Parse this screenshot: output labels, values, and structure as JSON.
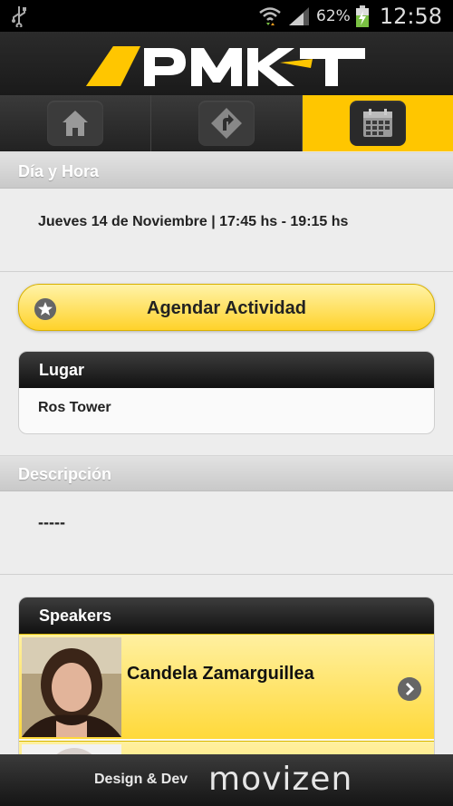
{
  "status_bar": {
    "battery_percent": "62%",
    "time": "12:58",
    "icons": [
      "usb-icon",
      "wifi-icon",
      "signal-icon",
      "battery-charging-icon"
    ]
  },
  "app": {
    "logo_text": "APMKT",
    "accent_color": "#ffc600"
  },
  "tabs": [
    {
      "name": "home",
      "icon": "home-icon",
      "active": false
    },
    {
      "name": "directions",
      "icon": "directions-sign-icon",
      "active": false
    },
    {
      "name": "calendar",
      "icon": "calendar-icon",
      "active": true
    }
  ],
  "date_section": {
    "title": "Día y Hora",
    "value": "Jueves 14 de Noviembre | 17:45 hs - 19:15 hs"
  },
  "schedule_button": {
    "label": "Agendar Actividad",
    "icon": "star-icon"
  },
  "place_card": {
    "title": "Lugar",
    "value": "Ros Tower"
  },
  "description_section": {
    "title": "Descripción",
    "value": "-----"
  },
  "speakers_card": {
    "title": "Speakers",
    "items": [
      {
        "name": "Candela Zamarguillea",
        "icon": "chevron-right-icon"
      },
      {
        "name": "",
        "icon": "chevron-right-icon"
      }
    ]
  },
  "footer": {
    "credit": "Design & Dev",
    "brand": "movizen"
  }
}
